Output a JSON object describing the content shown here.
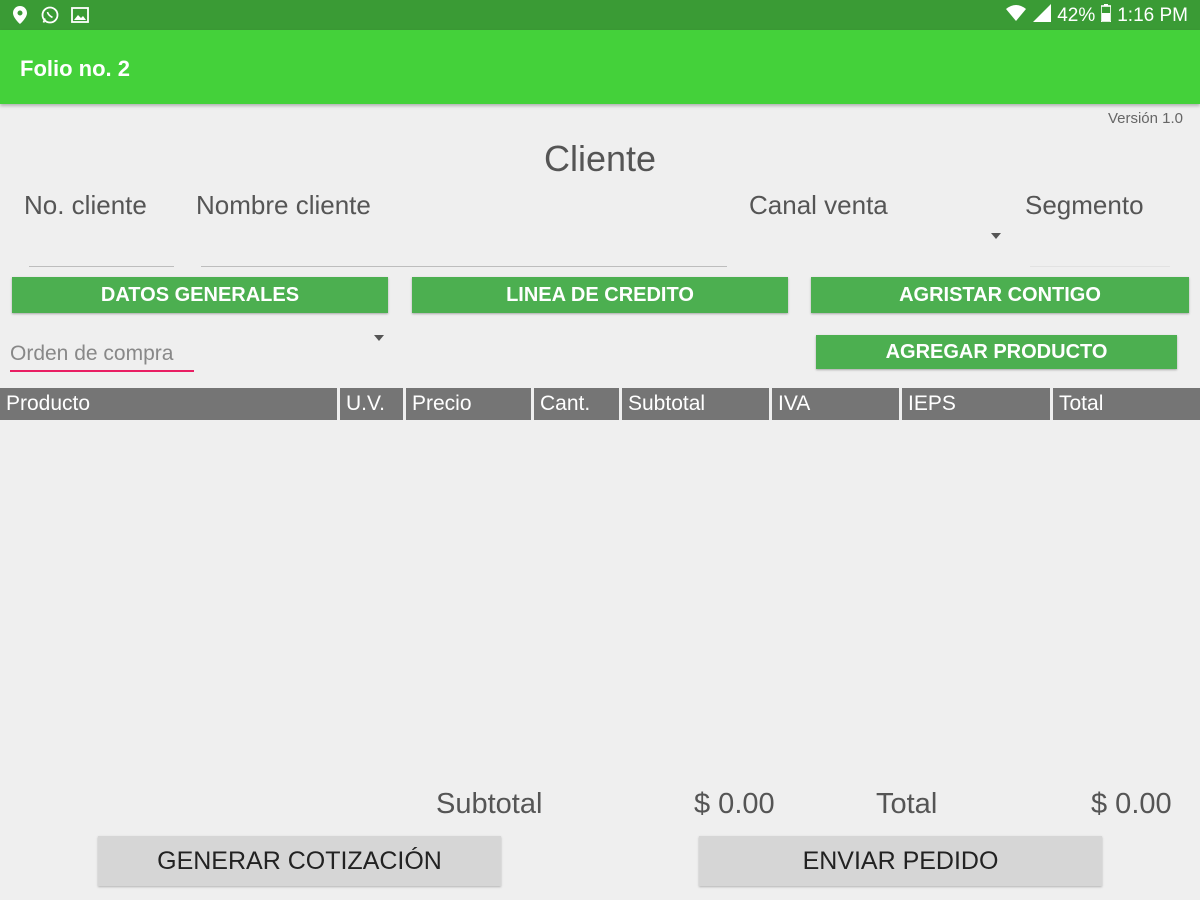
{
  "status_bar": {
    "left_icons": [
      "location-icon",
      "whatsapp-icon",
      "image-icon"
    ],
    "wifi_icon": "wifi-icon",
    "signal_icon": "signal-icon",
    "battery_percent": "42%",
    "battery_icon": "battery-icon",
    "time": "1:16 PM",
    "color": "#3a9b35"
  },
  "app_bar": {
    "title": "Folio no. 2",
    "color": "#44d13a"
  },
  "version": "Versión 1.0",
  "cliente": {
    "section_title": "Cliente",
    "labels": {
      "no_cliente": "No. cliente",
      "nombre_cliente": "Nombre cliente",
      "canal_venta": "Canal venta",
      "segmento": "Segmento"
    }
  },
  "buttons": {
    "datos_generales": "DATOS GENERALES",
    "linea_credito": "LINEA DE CREDITO",
    "agristar_contigo": "AGRISTAR CONTIGO",
    "agregar_producto": "AGREGAR PRODUCTO",
    "generar_cotizacion": "GENERAR COTIZACIÓN",
    "enviar_pedido": "ENVIAR PEDIDO"
  },
  "orden_compra": {
    "placeholder": "Orden de compra",
    "value": ""
  },
  "table": {
    "columns": [
      "Producto",
      "U.V.",
      "Precio",
      "Cant.",
      "Subtotal",
      "IVA",
      "IEPS",
      "Total"
    ],
    "rows": []
  },
  "summary": {
    "subtotal_label": "Subtotal",
    "subtotal_value": "$ 0.00",
    "total_label": "Total",
    "total_value": "$ 0.00"
  },
  "colors": {
    "accent_green": "#4caf50",
    "input_focus": "#e91e63",
    "table_header": "#757575"
  }
}
